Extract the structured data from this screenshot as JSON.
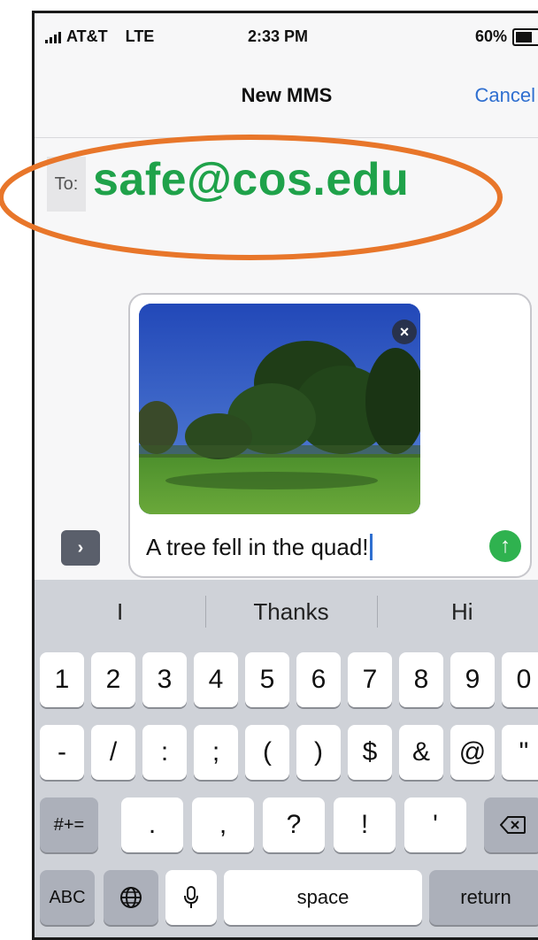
{
  "status_bar": {
    "carrier": "AT&T",
    "network": "LTE",
    "time": "2:33 PM",
    "battery": "60%"
  },
  "nav": {
    "title": "New MMS",
    "cancel_label": "Cancel"
  },
  "to_field": {
    "label": "To:",
    "value": "safe@cos.edu"
  },
  "message": {
    "text": "A tree fell in the quad!"
  },
  "predictions": [
    "I",
    "Thanks",
    "Hi"
  ],
  "keyboard": {
    "row1": [
      "1",
      "2",
      "3",
      "4",
      "5",
      "6",
      "7",
      "8",
      "9",
      "0"
    ],
    "row2": [
      "-",
      "/",
      ":",
      ";",
      "(",
      ")",
      "$",
      "&",
      "@",
      "\""
    ],
    "row3": [
      ".",
      ",",
      "?",
      "!",
      "'"
    ],
    "symbols_label": "#+=",
    "abc_label": "ABC",
    "space_label": "space",
    "return_label": "return"
  },
  "colors": {
    "accent": "#2f6fd0",
    "to_value": "#1fa24a",
    "send": "#2fb24f",
    "highlight": "#e8762a"
  },
  "icons": [
    "signal-icon",
    "battery-icon",
    "remove-photo-icon",
    "send-icon",
    "expand-chevron-icon",
    "globe-icon",
    "microphone-icon",
    "backspace-icon"
  ]
}
